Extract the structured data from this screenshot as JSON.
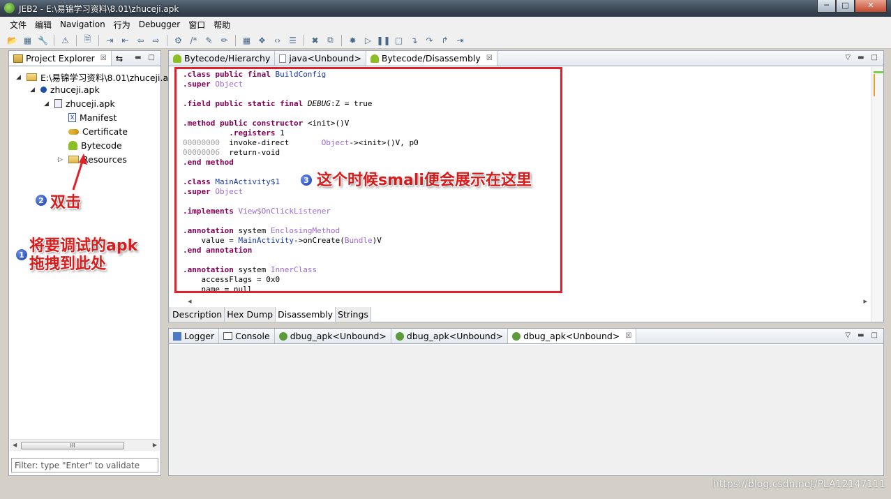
{
  "window": {
    "title": "JEB2 - E:\\易锦学习资料\\8.01\\zhuceji.apk",
    "min": "─",
    "max": "□",
    "close": "✕"
  },
  "menu": [
    "文件",
    "编辑",
    "Navigation",
    "行为",
    "Debugger",
    "窗口",
    "帮助"
  ],
  "left_panel": {
    "tab": "Project Explorer",
    "tree": [
      {
        "label": "E:\\易锦学习资料\\8.01\\zhuceji.a",
        "arrow": "◢"
      },
      {
        "label": "zhuceji.apk",
        "arrow": "◢"
      },
      {
        "label": "zhuceji.apk",
        "arrow": "◢"
      },
      {
        "label": "Manifest",
        "arrow": ""
      },
      {
        "label": "Certificate",
        "arrow": ""
      },
      {
        "label": "Bytecode",
        "arrow": ""
      },
      {
        "label": "Resources",
        "arrow": "▷"
      }
    ],
    "scroll_thumb": "III",
    "filter_placeholder": "Filter: type \"Enter\" to validate"
  },
  "editor": {
    "tabs": [
      {
        "label": "Bytecode/Hierarchy"
      },
      {
        "label": "java<Unbound>"
      },
      {
        "label": "Bytecode/Disassembly",
        "close": "☒"
      }
    ],
    "code": [
      [
        [
          ".class public final ",
          "kw"
        ],
        [
          "BuildConfig",
          "ty"
        ]
      ],
      [
        [
          ".super ",
          "kw"
        ],
        [
          "Object",
          "lt"
        ]
      ],
      [],
      [
        [
          ".field public static final ",
          "kw"
        ],
        [
          "DEBUG",
          "it"
        ],
        [
          ":Z = true",
          "pl"
        ]
      ],
      [],
      [
        [
          ".method public constructor ",
          "kw"
        ],
        [
          "<init>()V",
          "pl"
        ]
      ],
      [
        [
          "          .registers ",
          "kw"
        ],
        [
          "1",
          "pl"
        ]
      ],
      [
        [
          "00000000",
          "ad"
        ],
        [
          "  invoke-direct       ",
          "pl"
        ],
        [
          "Object",
          "lt"
        ],
        [
          "-><init>()V, p0",
          "pl"
        ]
      ],
      [
        [
          "00000006",
          "ad"
        ],
        [
          "  return-void",
          "pl"
        ]
      ],
      [
        [
          ".end method",
          "kw"
        ]
      ],
      [],
      [
        [
          ".class ",
          "kw"
        ],
        [
          "MainActivity$1",
          "ty"
        ]
      ],
      [
        [
          ".super ",
          "kw"
        ],
        [
          "Object",
          "lt"
        ]
      ],
      [],
      [
        [
          ".implements ",
          "kw"
        ],
        [
          "View$OnClickListener",
          "lt"
        ]
      ],
      [],
      [
        [
          ".annotation ",
          "kw"
        ],
        [
          "system ",
          "pl"
        ],
        [
          "EnclosingMethod",
          "lt"
        ]
      ],
      [
        [
          "    value = ",
          "pl"
        ],
        [
          "MainActivity",
          "ty"
        ],
        [
          "->onCreate(",
          "pl"
        ],
        [
          "Bundle",
          "lt"
        ],
        [
          ")V",
          "pl"
        ]
      ],
      [
        [
          ".end annotation",
          "kw"
        ]
      ],
      [],
      [
        [
          ".annotation ",
          "kw"
        ],
        [
          "system ",
          "pl"
        ],
        [
          "InnerClass",
          "lt"
        ]
      ],
      [
        [
          "    accessFlags = 0x0",
          "pl"
        ]
      ],
      [
        [
          "    name = null",
          "pl"
        ]
      ]
    ],
    "bottom_tabs": [
      "Description",
      "Hex Dump",
      "Disassembly",
      "Strings"
    ],
    "scroll_left": "◂",
    "scroll_right": "▸"
  },
  "console_panel": {
    "tabs": [
      {
        "label": "Logger"
      },
      {
        "label": "Console"
      },
      {
        "label": "dbug_apk<Unbound>"
      },
      {
        "label": "dbug_apk<Unbound>"
      },
      {
        "label": "dbug_apk<Unbound>",
        "close": "☒"
      }
    ]
  },
  "annotations": {
    "step1_num": "1",
    "step1_line1": "将要调试的apk",
    "step1_line2": "拖拽到此处",
    "step2_num": "2",
    "step2": "双击",
    "step3_num": "3",
    "step3": "这个时候smali便会展示在这里"
  },
  "watermark": "https://blog.csdn.net/PLA12147111",
  "colors": {
    "annotation_red": "#e0202a",
    "keyword": "#7f0055",
    "type": "#1a3aa8",
    "literal": "#9b6ad2"
  }
}
